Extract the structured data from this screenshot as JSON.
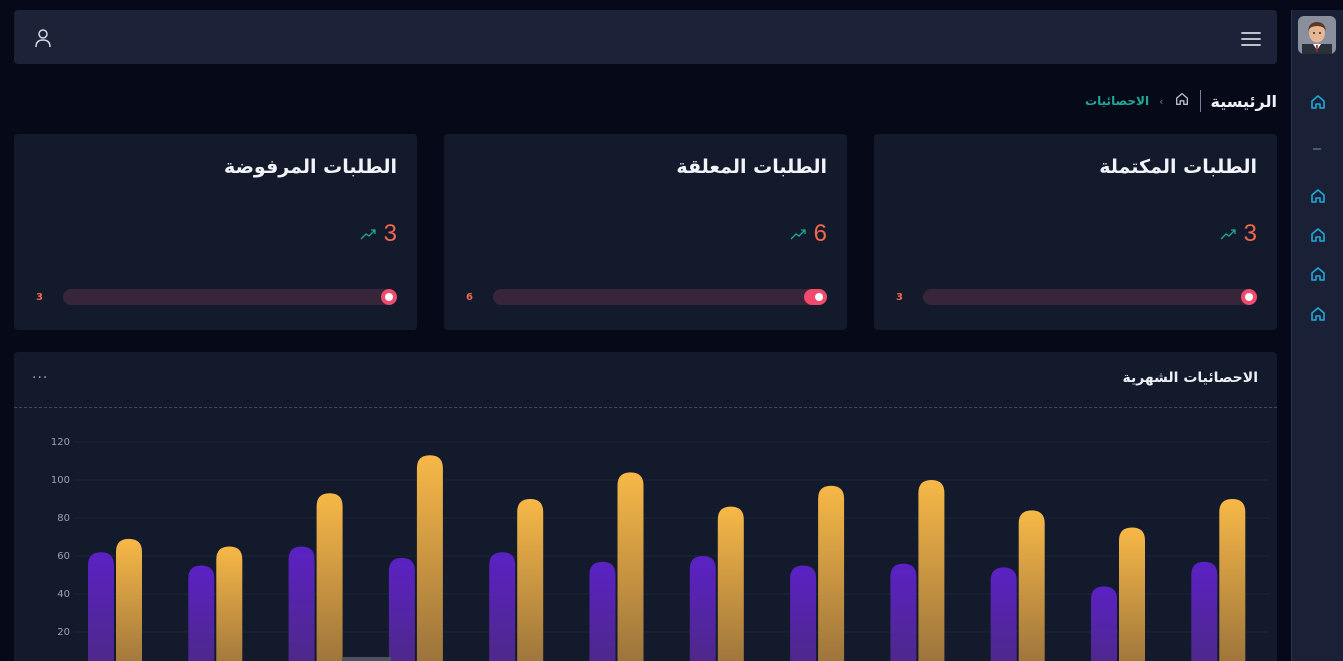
{
  "topbar": {
    "user_icon": "user-icon",
    "menu_icon": "hamburger-menu-icon"
  },
  "breadcrumb": {
    "title": "الرئيسية",
    "home_icon": "home-icon",
    "chevron": "‹",
    "current": "الاحصائيات"
  },
  "cards": [
    {
      "title": "الطلبات المكتملة",
      "value": "3",
      "small_value": "3",
      "progress": 0.02
    },
    {
      "title": "الطلبات المعلقة",
      "value": "6",
      "small_value": "6",
      "progress": 0.07
    },
    {
      "title": "الطلبات المرفوضة",
      "value": "3",
      "small_value": "3",
      "progress": 0.02
    }
  ],
  "panel": {
    "title": "الاحصائيات الشهرية",
    "more": "···"
  },
  "colors": {
    "accent_orange": "#f2684a",
    "accent_teal": "#1fa89a",
    "bar_purple": "#5b21c4",
    "bar_gold": "#f5b84a",
    "progress_pink": "#f04a6c"
  },
  "chart_data": {
    "type": "bar",
    "categories": [
      "",
      "",
      "",
      "",
      "",
      "",
      "",
      "",
      "",
      "",
      "",
      ""
    ],
    "series": [
      {
        "values": [
          62,
          55,
          65,
          59,
          62,
          57,
          60,
          55,
          56,
          54,
          44,
          57
        ]
      },
      {
        "values": [
          69,
          65,
          93,
          113,
          90,
          104,
          86,
          97,
          100,
          84,
          75,
          90
        ]
      }
    ],
    "yticks": [
      "20",
      "40",
      "60",
      "80",
      "100",
      "120"
    ],
    "ylim": [
      0,
      120
    ],
    "grid": true
  }
}
